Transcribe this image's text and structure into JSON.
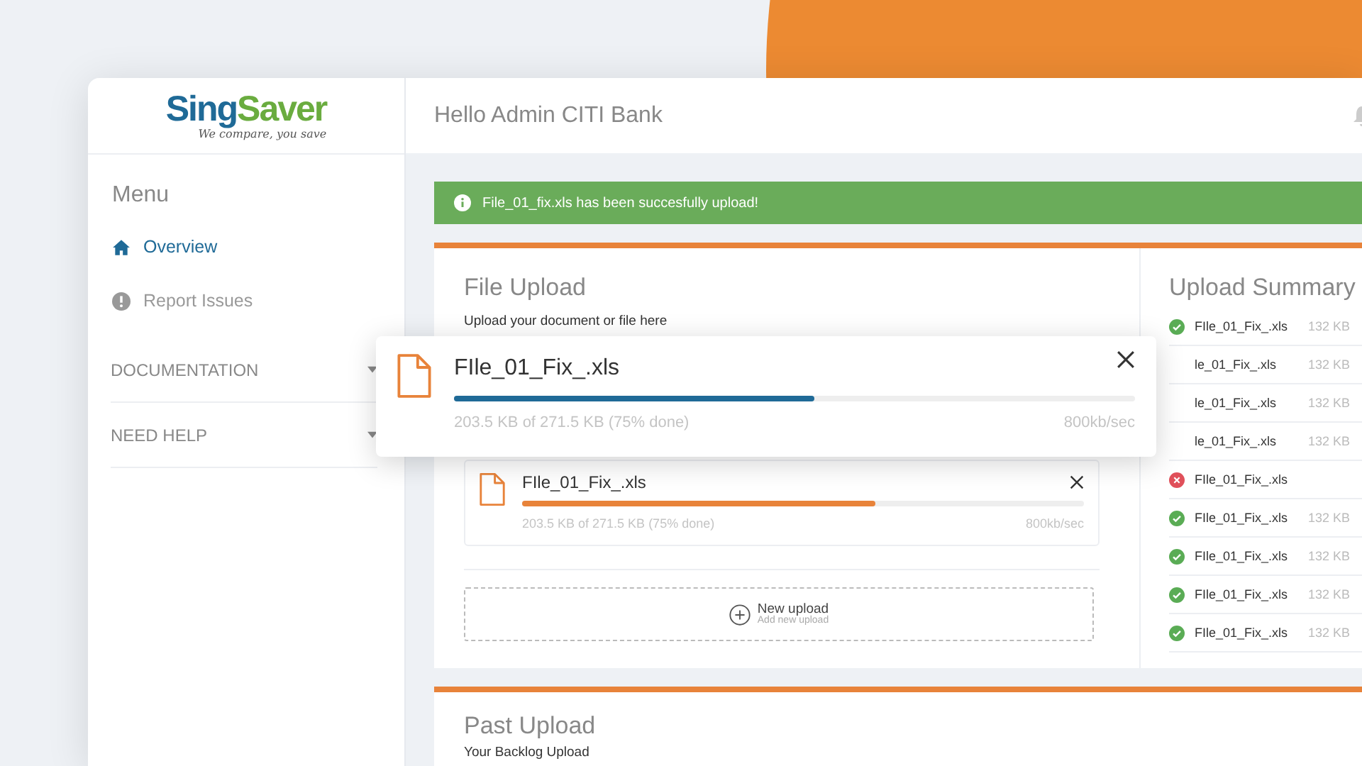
{
  "logo": {
    "brand_start": "Sing",
    "brand_end": "Saver",
    "tagline": "We compare, you save"
  },
  "header": {
    "greeting": "Hello Admin CITI Bank"
  },
  "sidebar": {
    "title": "Menu",
    "items": [
      {
        "label": "Overview",
        "selected": true,
        "kind": "home"
      },
      {
        "label": "Report Issues",
        "selected": false,
        "kind": "alert"
      }
    ],
    "sections": [
      {
        "label": "DOCUMENTATION"
      },
      {
        "label": "NEED HELP"
      }
    ]
  },
  "alert": {
    "message": "File_01_fix.xls has been succesfully upload!"
  },
  "file_upload": {
    "title": "File Upload",
    "subtitle": "Upload your document or file here",
    "items": [
      {
        "name": "FIle_01_Fix_.xls",
        "level": 0.63,
        "progress": "203.5 KB of 271.5 KB (75% done)",
        "speed": "800kb/sec"
      }
    ],
    "new_upload": {
      "label": "New upload",
      "hint": "Add new upload"
    }
  },
  "drag_preview": {
    "name": "FIle_01_Fix_.xls",
    "level": 0.53,
    "progress": "203.5 KB of 271.5 KB (75% done)",
    "speed": "800kb/sec"
  },
  "upload_summary": {
    "title": "Upload Summary",
    "files": [
      {
        "name": "FIle_01_Fix_.xls",
        "size": "132 KB",
        "failed": false
      },
      {
        "name": "le_01_Fix_.xls",
        "size": "132 KB"
      },
      {
        "name": "le_01_Fix_.xls",
        "size": "132 KB"
      },
      {
        "name": "le_01_Fix_.xls",
        "size": "132 KB"
      },
      {
        "name": "FIle_01_Fix_.xls",
        "failed": true
      },
      {
        "name": "FIle_01_Fix_.xls",
        "size": "132 KB",
        "failed": false
      },
      {
        "name": "FIle_01_Fix_.xls",
        "size": "132 KB",
        "failed": false
      },
      {
        "name": "FIle_01_Fix_.xls",
        "size": "132 KB",
        "failed": false
      },
      {
        "name": "FIle_01_Fix_.xls",
        "size": "132 KB",
        "failed": false
      }
    ]
  },
  "past_upload": {
    "title": "Past Upload",
    "subtitle": "Your Backlog Upload"
  }
}
